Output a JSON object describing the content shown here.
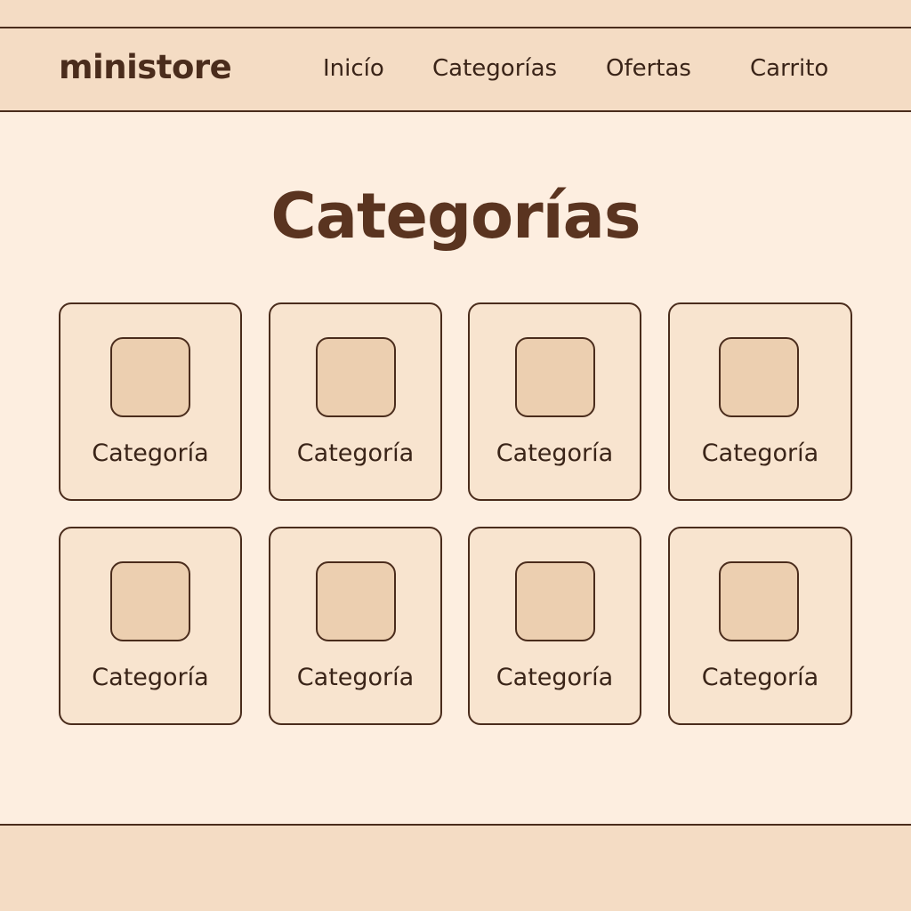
{
  "header": {
    "logo": "ministore",
    "nav": [
      {
        "label": "Inicío"
      },
      {
        "label": "Categorías"
      },
      {
        "label": "Ofertas"
      },
      {
        "label": "Carrito"
      }
    ]
  },
  "main": {
    "title": "Categorías",
    "categories": [
      {
        "label": "Categoría",
        "icon": "placeholder-image-icon"
      },
      {
        "label": "Categoría",
        "icon": "placeholder-image-icon"
      },
      {
        "label": "Categoría",
        "icon": "placeholder-image-icon"
      },
      {
        "label": "Categoría",
        "icon": "placeholder-image-icon"
      },
      {
        "label": "Categoría",
        "icon": "placeholder-image-icon"
      },
      {
        "label": "Categoría",
        "icon": "placeholder-image-icon"
      },
      {
        "label": "Categoría",
        "icon": "placeholder-image-icon"
      },
      {
        "label": "Categoría",
        "icon": "placeholder-image-icon"
      }
    ]
  },
  "colors": {
    "background": "#fdeee0",
    "navbar": "#f4dcc4",
    "border": "#4a2c1c",
    "card": "#f8e4cf",
    "thumb": "#eccfb0",
    "title": "#5a3420"
  }
}
